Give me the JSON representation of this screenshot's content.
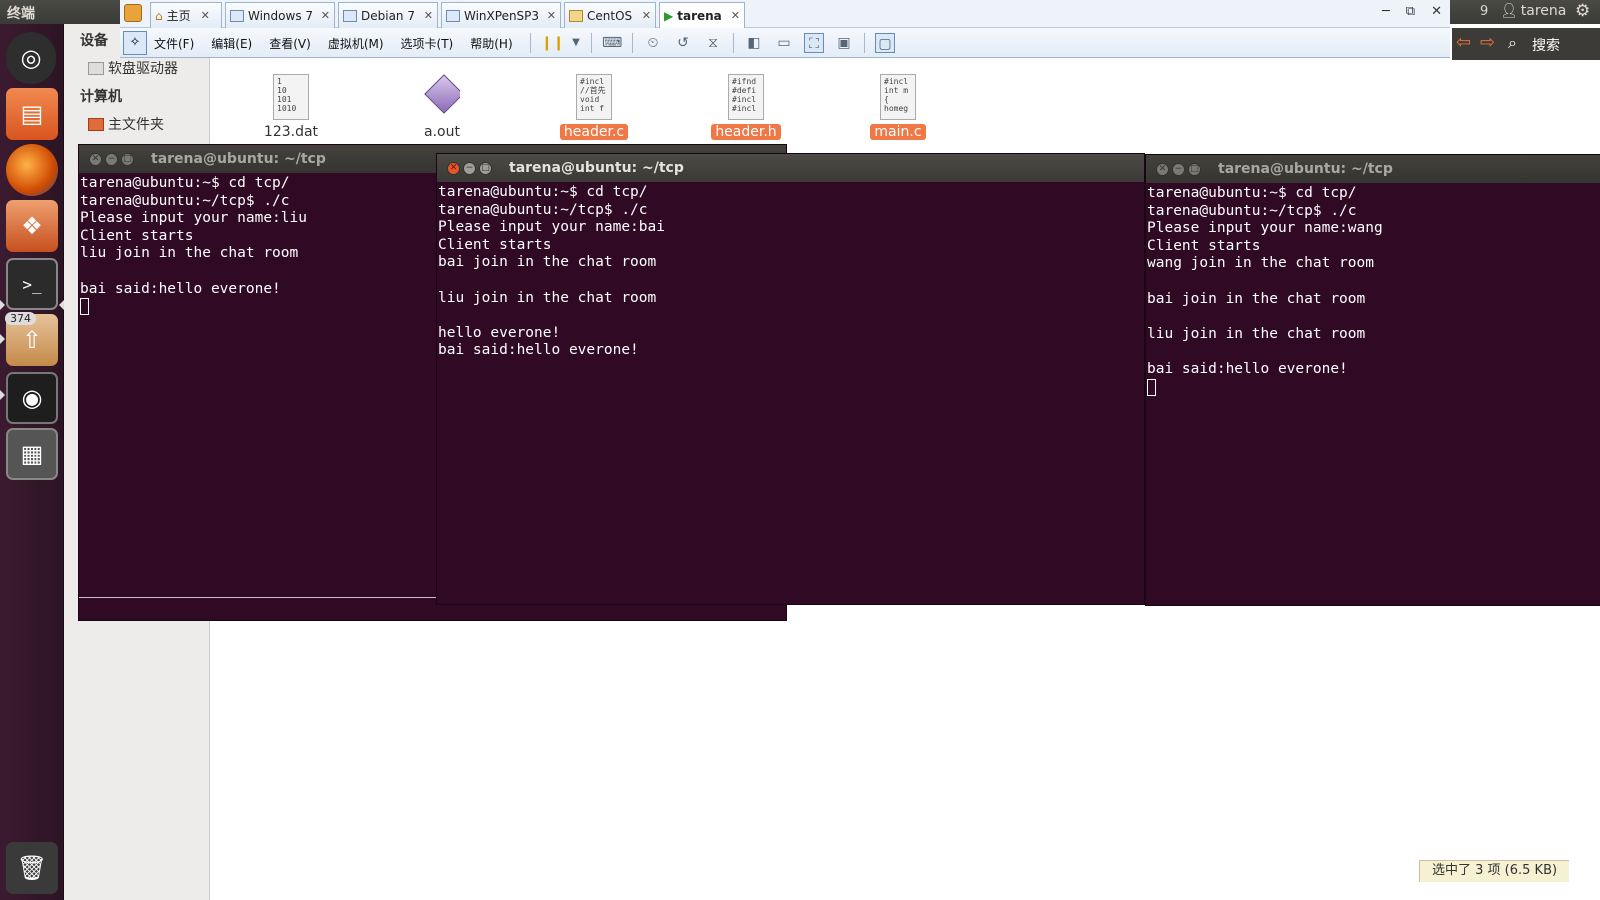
{
  "top_panel": {
    "app_title": "终端",
    "clock_fragment": "9",
    "user_name": "tarena"
  },
  "vmware": {
    "tabs": [
      {
        "label": "主页"
      },
      {
        "label": "Windows 7"
      },
      {
        "label": "Debian 7"
      },
      {
        "label": "WinXPenSP3"
      },
      {
        "label": "CentOS"
      },
      {
        "label": "tarena"
      }
    ],
    "menus": [
      "文件(F)",
      "编辑(E)",
      "查看(V)",
      "虚拟机(M)",
      "选项卡(T)",
      "帮助(H)"
    ]
  },
  "file_manager": {
    "search_label": "搜索",
    "sidebar": {
      "section_devices": "设备",
      "floppy": "软盘驱动器",
      "section_computer": "计算机",
      "home": "主文件夹"
    },
    "files": [
      {
        "name": "123.dat",
        "preview": "1\n10\n101\n1010",
        "selected": false
      },
      {
        "name": "a.out",
        "preview": "",
        "selected": false
      },
      {
        "name": "header.c",
        "preview": "#incl\n//首先\nvoid\nint f",
        "selected": true
      },
      {
        "name": "header.h",
        "preview": "#ifnd\n#defi\n#incl\n#incl",
        "selected": true
      },
      {
        "name": "main.c",
        "preview": "#incl\nint m\n{\nhomeg",
        "selected": true
      }
    ],
    "status": "选中了 3 项 (6.5 KB)"
  },
  "terminals": [
    {
      "title": "tarena@ubuntu: ~/tcp",
      "lines": [
        "tarena@ubuntu:~$ cd tcp/",
        "tarena@ubuntu:~/tcp$ ./c",
        "Please input your name:liu",
        "Client starts",
        "liu join in the chat room",
        "",
        "bai said:hello everone!"
      ]
    },
    {
      "title": "tarena@ubuntu: ~/tcp",
      "lines": [
        "tarena@ubuntu:~$ cd tcp/",
        "tarena@ubuntu:~/tcp$ ./c",
        "Please input your name:bai",
        "Client starts",
        "bai join in the chat room",
        "",
        "liu join in the chat room",
        "",
        "hello everone!",
        "bai said:hello everone!"
      ]
    },
    {
      "title": "tarena@ubuntu: ~/tcp",
      "lines": [
        "tarena@ubuntu:~$ cd tcp/",
        "tarena@ubuntu:~/tcp$ ./c",
        "Please input your name:wang",
        "Client starts",
        "wang join in the chat room",
        "",
        "bai join in the chat room",
        "",
        "liu join in the chat room",
        "",
        "bai said:hello everone!"
      ]
    }
  ],
  "launcher": {
    "updates_badge": "374"
  },
  "colors": {
    "terminal_bg": "#300a24",
    "selection": "#f07746",
    "launcher_bg": "#3b1a2f"
  }
}
